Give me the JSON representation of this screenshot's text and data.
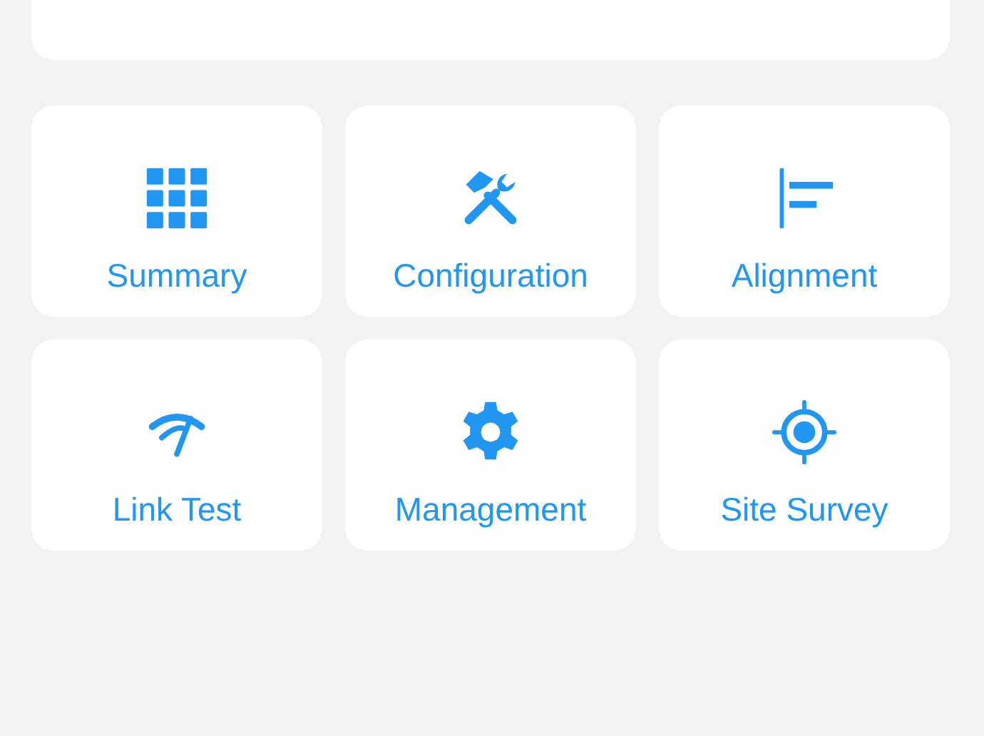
{
  "tiles": [
    {
      "label": "Summary",
      "kind": "grid"
    },
    {
      "label": "Configuration",
      "kind": "tools"
    },
    {
      "label": "Alignment",
      "kind": "align"
    },
    {
      "label": "Link Test",
      "kind": "signal"
    },
    {
      "label": "Management",
      "kind": "gear"
    },
    {
      "label": "Site Survey",
      "kind": "target"
    }
  ]
}
